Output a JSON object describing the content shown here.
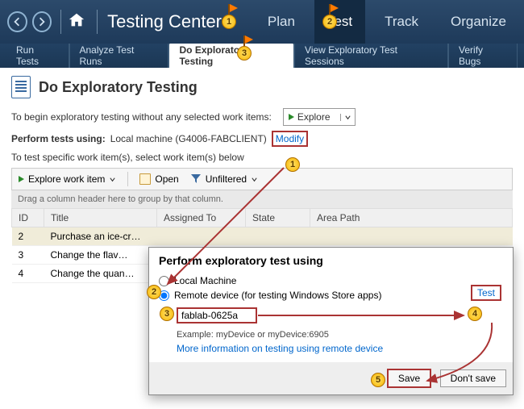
{
  "app_title": "Testing Center",
  "main_tabs": [
    "Plan",
    "Test",
    "Track",
    "Organize"
  ],
  "main_tab_active": 1,
  "sub_tabs": [
    "Run Tests",
    "Analyze Test Runs",
    "Do Exploratory Testing",
    "View Exploratory Test Sessions",
    "Verify Bugs"
  ],
  "sub_tab_active": 2,
  "page_heading": "Do Exploratory Testing",
  "intro": {
    "no_work_items": "To begin exploratory testing without any selected work items:",
    "explore_label": "Explore",
    "perform_using_label": "Perform tests using:",
    "perform_using_value": "Local machine (G4006-FABCLIENT)",
    "modify_label": "Modify",
    "specific_text": "To test specific work item(s), select work item(s) below"
  },
  "toolbar": {
    "explore_work_item": "Explore work item",
    "open": "Open",
    "unfiltered": "Unfiltered"
  },
  "drag_hint": "Drag a column header here to group by that column.",
  "columns": [
    "ID",
    "Title",
    "Assigned To",
    "State",
    "Area Path"
  ],
  "rows": [
    {
      "id": "2",
      "title": "Purchase an ice-cr…"
    },
    {
      "id": "3",
      "title": "Change the flav…"
    },
    {
      "id": "4",
      "title": "Change the quan…"
    }
  ],
  "popup": {
    "title": "Perform exploratory test using",
    "opt_local": "Local Machine",
    "opt_remote": "Remote device (for testing Windows Store apps)",
    "device_value": "fablab-0625a",
    "test_label": "Test",
    "example": "Example: myDevice or myDevice:6905",
    "more_link": "More information on testing using remote device",
    "save": "Save",
    "dont_save": "Don't save"
  },
  "callouts": {
    "c1": "1",
    "c2": "2",
    "c3": "3",
    "c4": "4",
    "c5": "5",
    "f1": "1",
    "f2": "2",
    "f3": "3"
  }
}
